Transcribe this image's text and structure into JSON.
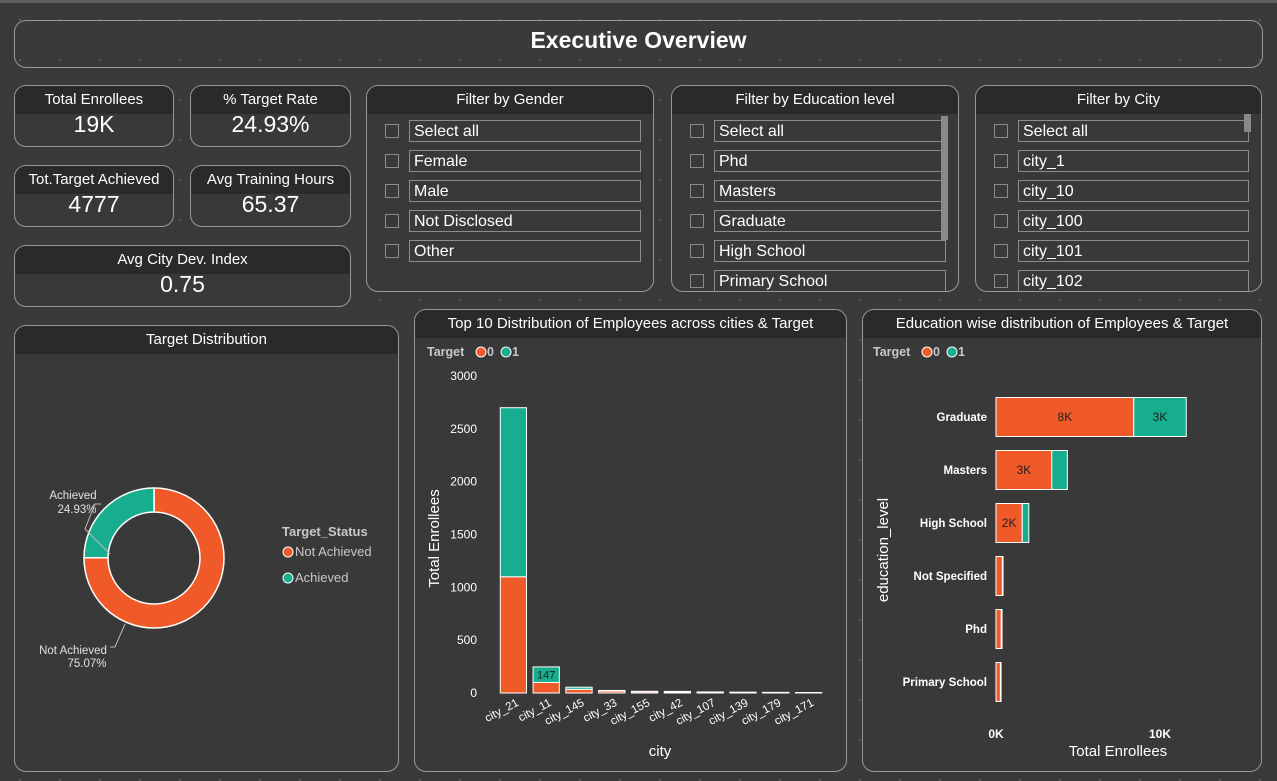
{
  "header": {
    "title": "Executive Overview"
  },
  "kpis": {
    "total_enrollees": {
      "label": "Total Enrollees",
      "value": "19K"
    },
    "target_rate": {
      "label": "% Target Rate",
      "value": "24.93%"
    },
    "target_achieved": {
      "label": "Tot.Target Achieved",
      "value": "4777"
    },
    "avg_training_hours": {
      "label": "Avg Training Hours",
      "value": "65.37"
    },
    "avg_city_dev": {
      "label": "Avg City Dev. Index",
      "value": "0.75"
    }
  },
  "slicers": {
    "gender": {
      "title": "Filter by Gender",
      "options": [
        "Select all",
        "Female",
        "Male",
        "Not Disclosed",
        "Other"
      ]
    },
    "education": {
      "title": "Filter by Education level",
      "options": [
        "Select all",
        "Phd",
        "Masters",
        "Graduate",
        "High School",
        "Primary School"
      ]
    },
    "city": {
      "title": "Filter by City",
      "options": [
        "Select all",
        "city_1",
        "city_10",
        "city_100",
        "city_101",
        "city_102"
      ]
    }
  },
  "colors": {
    "not_achieved": "#f05a28",
    "achieved": "#17ad8f",
    "panel_head": "#2b2a2a"
  },
  "chart_data": [
    {
      "type": "pie",
      "title": "Target Distribution",
      "legend_title": "Target_Status",
      "legend_position": "right",
      "slices": [
        {
          "name": "Not Achieved",
          "percent": 75.07,
          "label": "75.07%"
        },
        {
          "name": "Achieved",
          "percent": 24.93,
          "label": "24.93%"
        }
      ]
    },
    {
      "type": "bar",
      "title": "Top 10 Distribution of Employees across cities & Target",
      "legend_title": "Target",
      "legend_position": "top-left",
      "xlabel": "city",
      "ylabel": "Total Enrollees",
      "ylim": [
        0,
        3000
      ],
      "yticks": [
        "0",
        "500",
        "1000",
        "1500",
        "2000",
        "2500",
        "3000"
      ],
      "categories": [
        "city_21",
        "city_11",
        "city_145",
        "city_33",
        "city_155",
        "city_42",
        "city_107",
        "city_139",
        "city_179",
        "city_171"
      ],
      "series": [
        {
          "name": "0",
          "values": [
            1100,
            100,
            35,
            18,
            12,
            10,
            7,
            5,
            4,
            3
          ]
        },
        {
          "name": "1",
          "values": [
            1600,
            147,
            20,
            6,
            4,
            5,
            3,
            3,
            2,
            1
          ]
        }
      ],
      "data_labels": [
        {
          "category": "city_11",
          "series": "1",
          "text": "147"
        }
      ]
    },
    {
      "type": "bar",
      "orientation": "horizontal",
      "title": "Education wise distribution of Employees & Target",
      "legend_title": "Target",
      "legend_position": "top-left",
      "xlabel": "Total Enrollees",
      "ylabel": "education_level",
      "xlim": [
        0,
        12000
      ],
      "xticks": [
        "0K",
        "10K"
      ],
      "categories": [
        "Graduate",
        "Masters",
        "High School",
        "Not Specified",
        "Phd",
        "Primary School"
      ],
      "series": [
        {
          "name": "0",
          "values": [
            8400,
            3400,
            1600,
            390,
            320,
            270
          ]
        },
        {
          "name": "1",
          "values": [
            3200,
            950,
            400,
            40,
            50,
            40
          ]
        }
      ],
      "data_labels": [
        {
          "category": "Graduate",
          "series": "0",
          "text": "8K"
        },
        {
          "category": "Graduate",
          "series": "1",
          "text": "3K"
        },
        {
          "category": "Masters",
          "series": "0",
          "text": "3K"
        },
        {
          "category": "High School",
          "series": "0",
          "text": "2K"
        }
      ]
    }
  ]
}
